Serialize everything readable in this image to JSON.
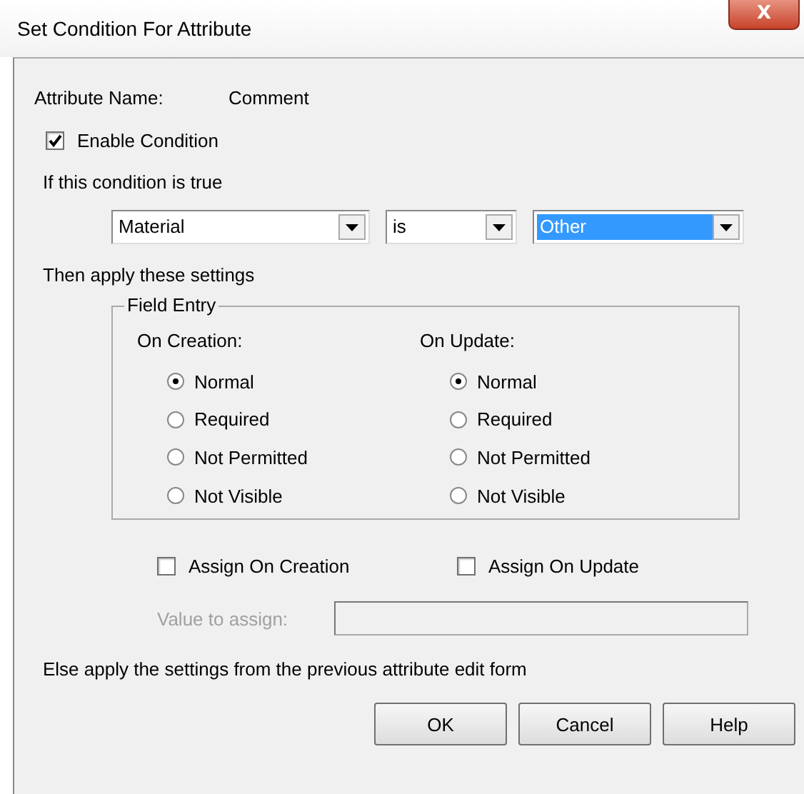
{
  "window": {
    "title": "Set Condition For Attribute",
    "close": "X"
  },
  "attribute": {
    "label": "Attribute Name:",
    "value": "Comment"
  },
  "enable_condition": {
    "label": "Enable Condition",
    "checked": true
  },
  "condition_label": "If this condition is true",
  "condition": [
    {
      "value": "Material",
      "highlighted": false
    },
    {
      "value": "is",
      "highlighted": false
    },
    {
      "value": "Other",
      "highlighted": true
    }
  ],
  "settings_label": "Then apply these settings",
  "field_entry": {
    "title": "Field Entry",
    "columns": [
      {
        "heading": "On Creation:",
        "options": [
          {
            "label": "Normal",
            "selected": true
          },
          {
            "label": "Required",
            "selected": false
          },
          {
            "label": "Not Permitted",
            "selected": false
          },
          {
            "label": "Not Visible",
            "selected": false
          }
        ]
      },
      {
        "heading": "On Update:",
        "options": [
          {
            "label": "Normal",
            "selected": true
          },
          {
            "label": "Required",
            "selected": false
          },
          {
            "label": "Not Permitted",
            "selected": false
          },
          {
            "label": "Not Visible",
            "selected": false
          }
        ]
      }
    ]
  },
  "assign": [
    {
      "label": "Assign On Creation",
      "checked": false
    },
    {
      "label": "Assign On Update",
      "checked": false
    }
  ],
  "value_to_assign": {
    "label": "Value to assign:",
    "disabled": true
  },
  "else_label": "Else apply the settings from the previous attribute edit form",
  "buttons": [
    "OK",
    "Cancel",
    "Help"
  ]
}
